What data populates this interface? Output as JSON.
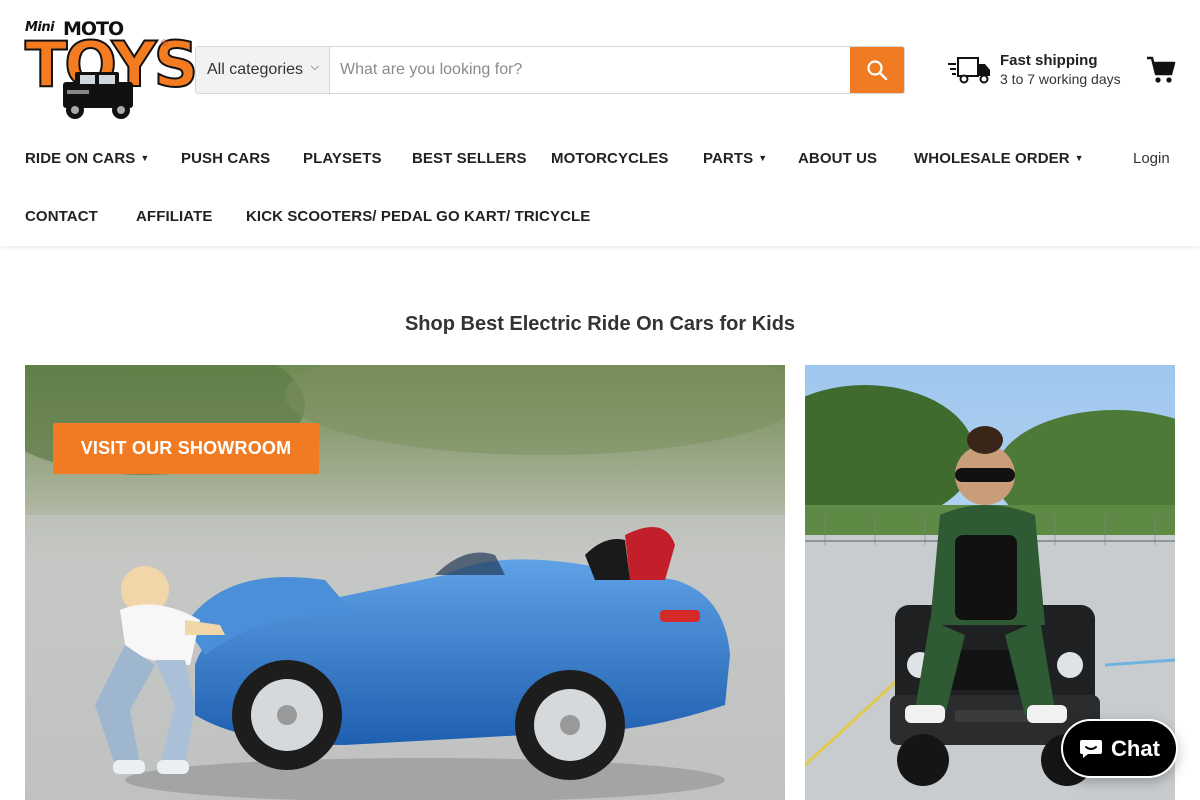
{
  "header": {
    "logo": {
      "mini": "Mini",
      "moto": "MOTO",
      "toys": "TOYS",
      "reg": "®"
    },
    "search": {
      "category_label": "All categories",
      "placeholder": "What are you looking for?"
    },
    "shipping": {
      "title": "Fast shipping",
      "subtitle": "3 to 7 working days"
    },
    "login_label": "Login",
    "nav": {
      "ride_on_cars": "RIDE ON CARS",
      "push_cars": "PUSH CARS",
      "playsets": "PLAYSETS",
      "best_sellers": "BEST SELLERS",
      "motorcycles": "MOTORCYCLES",
      "parts": "PARTS",
      "about_us": "ABOUT US",
      "wholesale_order": "WHOLESALE ORDER",
      "contact": "CONTACT",
      "affiliate": "AFFILIATE",
      "kick_scooters": "KICK SCOOTERS/ PEDAL GO KART/ TRICYCLE"
    },
    "icons": {
      "search": "search-icon",
      "shipping": "truck-icon",
      "cart": "cart-icon",
      "dropdown": "chevron-down-icon"
    }
  },
  "main": {
    "section_title": "Shop Best Electric Ride On Cars for Kids",
    "showroom_button": "VISIT OUR SHOWROOM"
  },
  "chat": {
    "label": "Chat",
    "icon": "chat-bubble-icon"
  },
  "colors": {
    "accent": "#f07b22",
    "text": "#222222",
    "chat_bg": "#000000"
  }
}
